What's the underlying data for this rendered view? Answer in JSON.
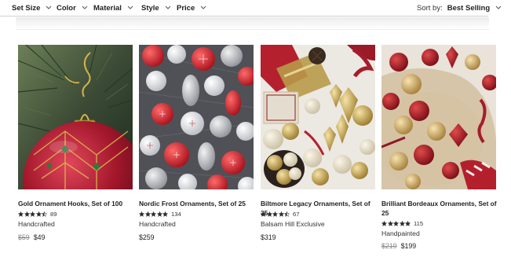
{
  "filters": [
    {
      "label": "Set Size"
    },
    {
      "label": "Color"
    },
    {
      "label": "Material"
    },
    {
      "label": "Style"
    },
    {
      "label": "Price"
    }
  ],
  "sort": {
    "label": "Sort by:",
    "value": "Best Selling"
  },
  "colors": {
    "star": "#2b2b2b",
    "strike": "#8a8a8a"
  },
  "products": [
    {
      "name": "Gold Ornament Hooks, Set of 100",
      "rating": 4.5,
      "reviews": "89",
      "tag": "Handcrafted",
      "price_was": "$59",
      "price": "$49"
    },
    {
      "name": "Nordic Frost Ornaments, Set of 25",
      "rating": 5,
      "reviews": "134",
      "tag": "Handcrafted",
      "price_was": "",
      "price": "$259"
    },
    {
      "name": "Biltmore Legacy Ornaments, Set of 35",
      "rating": 4.5,
      "reviews": "67",
      "tag": "Balsam Hill Exclusive",
      "price_was": "",
      "price": "$319"
    },
    {
      "name": "Brilliant Bordeaux Ornaments, Set of 25",
      "rating": 5,
      "reviews": "115",
      "tag": "Handpainted",
      "price_was": "$219",
      "price": "$199"
    }
  ]
}
